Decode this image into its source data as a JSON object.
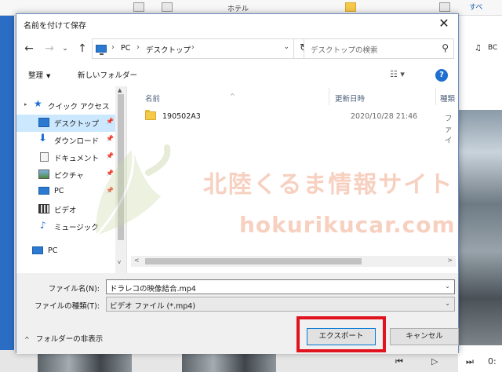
{
  "dialog": {
    "title": "名前を付けて保存",
    "close_symbol": "✕"
  },
  "nav": {
    "back_symbol": "←",
    "forward_symbol": "→",
    "dropdown_symbol": "⌄",
    "up_symbol": "↑",
    "address": [
      "PC",
      "デスクトップ"
    ],
    "address_sep": "›",
    "address_drop": "⌄",
    "refresh_symbol": "↻",
    "search_placeholder": "デスクトップの検索",
    "search_symbol": "⚲"
  },
  "toolbar": {
    "organize_label": "整理",
    "organize_caret": "▼",
    "new_folder_label": "新しいフォルダー",
    "view_symbol": "☷ ▾",
    "help_symbol": "?"
  },
  "tree": {
    "quick_access": "クイック アクセス",
    "items": [
      {
        "label": "デスクトップ",
        "icon": "desktop-icon"
      },
      {
        "label": "ダウンロード",
        "icon": "download-icon"
      },
      {
        "label": "ドキュメント",
        "icon": "document-icon"
      },
      {
        "label": "ピクチャ",
        "icon": "picture-icon"
      },
      {
        "label": "PC",
        "icon": "pc-icon"
      },
      {
        "label": "ビデオ",
        "icon": "video-icon"
      },
      {
        "label": "ミュージック",
        "icon": "music-icon"
      }
    ],
    "pc_label": "PC",
    "pin_symbol": "📌",
    "caret_symbol": "▸",
    "download_symbol": "⬇",
    "star_symbol": "★",
    "music_symbol": "♪"
  },
  "columns": {
    "name": "名前",
    "modified": "更新日時",
    "type": "種類",
    "sort_symbol": "^"
  },
  "files": [
    {
      "name": "190502A3",
      "modified": "2020/10/28 21:46",
      "type": "ファイ"
    }
  ],
  "scroll": {
    "up_symbol": "▲",
    "down_symbol": "v",
    "left_symbol": "<",
    "right_symbol": ">"
  },
  "form": {
    "filename_label": "ファイル名(N):",
    "filename_value": "ドラレコの映像結合.mp4",
    "filetype_label": "ファイルの種類(T):",
    "filetype_value": "ビデオ ファイル (*.mp4)",
    "drop_symbol": "⌄"
  },
  "footer": {
    "hide_folders_label": "フォルダーの非表示",
    "hide_caret": "^",
    "export_label": "エクスポート",
    "cancel_label": "キャンセル"
  },
  "watermark": {
    "line1": "北陸くるま情報サイト",
    "line2": "hokurikucar.com"
  },
  "background": {
    "music_symbol": "♫",
    "music_text": "BC",
    "top_right_text": "すべ",
    "ribbon_text": "ホテル",
    "player_prev": "⏮",
    "player_play": "▷",
    "player_next": "⏭",
    "player_time": "0:"
  },
  "colors": {
    "accent": "#0078d7",
    "highlight": "#e0141e",
    "selected": "#cce8ff"
  }
}
